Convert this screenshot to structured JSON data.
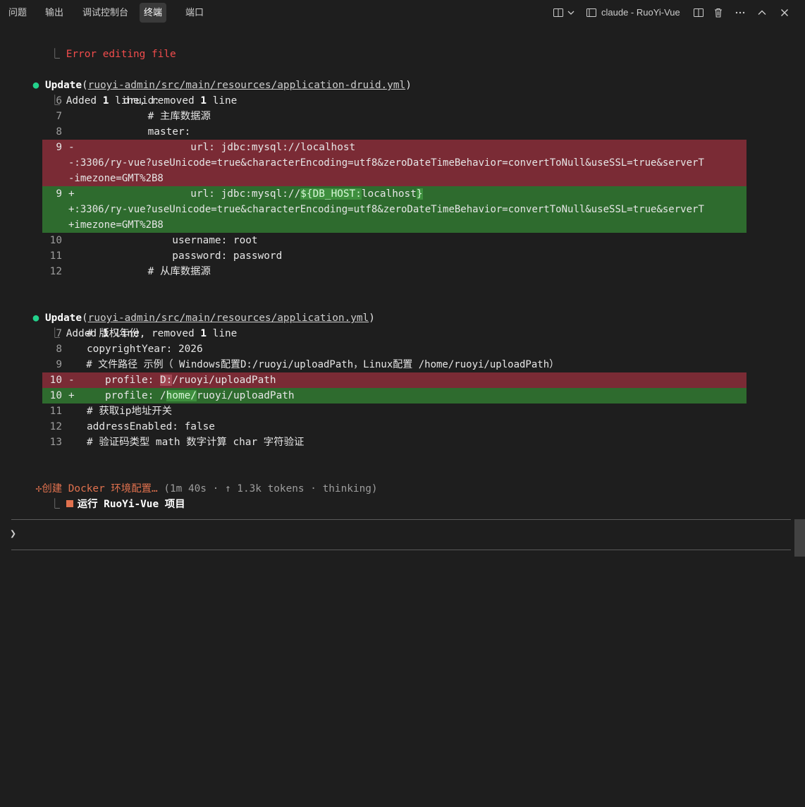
{
  "panel": {
    "tabs": [
      {
        "label": "问题"
      },
      {
        "label": "输出"
      },
      {
        "label": "调试控制台"
      },
      {
        "label": "终端",
        "active": true
      },
      {
        "label": "端口"
      }
    ],
    "terminal_title": "claude - RuoYi-Vue",
    "icons": [
      "split-layout-icon",
      "chevron-down-icon",
      "terminal-icon",
      "split-editor-icon",
      "trash-icon",
      "ellipsis-icon",
      "chevron-up-icon",
      "close-icon"
    ]
  },
  "term": {
    "l1": {
      "tree": "⎿ ",
      "text": "Error editing file"
    },
    "b1": {
      "dot": "●",
      "verb": "Update",
      "open": "(",
      "path": "ruoyi-admin/src/main/resources/application-druid.yml",
      "close": ")",
      "sum_tree": "⎿ ",
      "sum_a": "Added ",
      "sum_n1": "1",
      "sum_b": " line, removed ",
      "sum_n2": "1",
      "sum_c": " line",
      "r6": {
        "num": "6",
        "text": "         druid:"
      },
      "r7": {
        "num": "7",
        "text": "             # 主库数据源"
      },
      "r8": {
        "num": "8",
        "text": "             master:"
      },
      "d9a": {
        "num": "9",
        "sign": "-",
        "text": "                 url: jdbc:mysql://localhost"
      },
      "d9b": "-:3306/ry-vue?useUnicode=true&characterEncoding=utf8&zeroDateTimeBehavior=convertToNull&useSSL=true&serverT",
      "d9c": "-imezone=GMT%2B8",
      "a9a": {
        "num": "9",
        "sign": "+",
        "pre": "                 url: jdbc:mysql://",
        "hl": "${DB_HOST:",
        "mid": "localhost",
        "hl2": "}"
      },
      "a9b": "+:3306/ry-vue?useUnicode=true&characterEncoding=utf8&zeroDateTimeBehavior=convertToNull&useSSL=true&serverT",
      "a9c": "+imezone=GMT%2B8",
      "r10": {
        "num": "10",
        "text": "                 username: root"
      },
      "r11": {
        "num": "11",
        "text": "                 password: password"
      },
      "r12": {
        "num": "12",
        "text": "             # 从库数据源"
      }
    },
    "b2": {
      "dot": "●",
      "verb": "Update",
      "open": "(",
      "path": "ruoyi-admin/src/main/resources/application.yml",
      "close": ")",
      "sum_tree": "⎿ ",
      "sum_a": "Added ",
      "sum_n1": "1",
      "sum_b": " line, removed ",
      "sum_n2": "1",
      "sum_c": " line",
      "r7": {
        "num": "7",
        "text": "   # 版权年份"
      },
      "r8": {
        "num": "8",
        "text": "   copyrightYear: 2026"
      },
      "r9": {
        "num": "9",
        "text": "   # 文件路径 示例（ Windows配置D:/ruoyi/uploadPath，Linux配置 /home/ruoyi/uploadPath）"
      },
      "d10": {
        "num": "10",
        "sign": "-",
        "pre": "   profile: ",
        "hl": "D:",
        "post": "/ruoyi/uploadPath"
      },
      "a10": {
        "num": "10",
        "sign": "+",
        "pre": "   profile: /",
        "hl": "home/",
        "post": "ruoyi/uploadPath"
      },
      "r11": {
        "num": "11",
        "text": "   # 获取ip地址开关"
      },
      "r12": {
        "num": "12",
        "text": "   addressEnabled: false"
      },
      "r13": {
        "num": "13",
        "text": "   # 验证码类型 math 数字计算 char 字符验证"
      }
    },
    "status": {
      "glyph": "✢",
      "task": "创建 Docker 环境配置…",
      "meta": " (1m 40s · ↑ 1.3k tokens · thinking)"
    },
    "todo": {
      "tree": "⎿ ",
      "label": "运行 RuoYi-Vue 项目"
    }
  },
  "prompt": {
    "arrow": "❯",
    "value": ""
  },
  "colors": {
    "bg": "#1e1e1e",
    "deleted": "#7a2b35",
    "added": "#2e6b2e",
    "error": "#f14c4c",
    "accent": "#e0714e",
    "success": "#23d18b"
  }
}
